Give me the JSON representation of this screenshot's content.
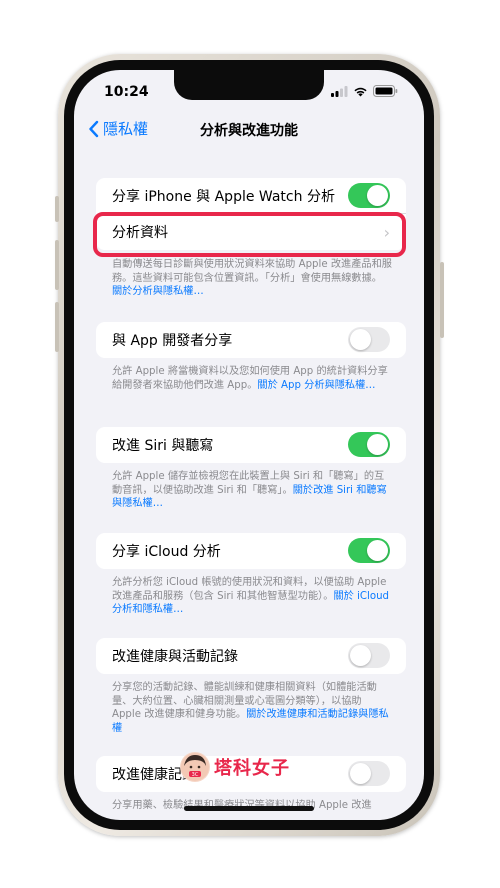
{
  "status_bar": {
    "time": "10:24"
  },
  "nav": {
    "back_label": "隱私權",
    "title": "分析與改進功能"
  },
  "groups": [
    {
      "rows": [
        {
          "label": "分享 iPhone 與 Apple Watch 分析",
          "toggle": "on"
        },
        {
          "label": "分析資料",
          "chevron": "›"
        }
      ],
      "footnote": "自動傳送每日診斷與使用狀況資料來協助 Apple 改進產品和服務。這些資料可能包含位置資訊。「分析」會使用無線數據。",
      "footnote_link": "關於分析與隱私權…"
    },
    {
      "rows": [
        {
          "label": "與 App 開發者分享",
          "toggle": "off"
        }
      ],
      "footnote": "允許 Apple 將當機資料以及您如何使用 App 的統計資料分享給開發者來協助他們改進 App。",
      "footnote_link": "關於 App 分析與隱私權…"
    },
    {
      "rows": [
        {
          "label": "改進 Siri 與聽寫",
          "toggle": "on"
        }
      ],
      "footnote": "允許 Apple 儲存並檢視您在此裝置上與 Siri 和「聽寫」的互動音訊，以便協助改進 Siri 和「聽寫」。",
      "footnote_link": "關於改進 Siri 和聽寫與隱私權…"
    },
    {
      "rows": [
        {
          "label": "分享 iCloud 分析",
          "toggle": "on"
        }
      ],
      "footnote": "允許分析您 iCloud 帳號的使用狀況和資料，以便協助 Apple 改進產品和服務（包含 Siri 和其他智慧型功能）。",
      "footnote_link": "關於 iCloud 分析和隱私權…"
    },
    {
      "rows": [
        {
          "label": "改進健康與活動記錄",
          "toggle": "off"
        }
      ],
      "footnote": "分享您的活動記錄、體能訓練和健康相關資料（如體能活動量、大約位置、心臟相關測量或心電圖分類等），以協助 Apple 改進健康和健身功能。",
      "footnote_link": "關於改進健康和活動記錄與隱私權"
    },
    {
      "rows": [
        {
          "label": "改進健康記錄",
          "toggle": "off"
        }
      ],
      "footnote": "分享用藥、檢驗結果和醫療狀況等資料以協助 Apple 改進"
    }
  ],
  "watermark": {
    "text": "塔科女子",
    "badge": "3C"
  },
  "colors": {
    "accent": "#0a7aff",
    "toggle_on": "#34c759",
    "highlight": "#e8274b"
  },
  "icons": [
    "signal-icon",
    "wifi-icon",
    "battery-icon",
    "chevron-left-icon",
    "chevron-right-icon"
  ]
}
